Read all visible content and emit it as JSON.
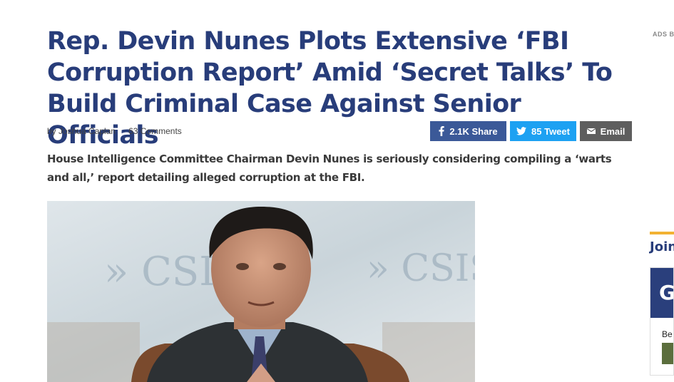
{
  "article": {
    "headline": "Rep. Devin Nunes Plots Extensive ‘FBI Corruption Report’ Amid ‘Secret Talks’ To Build Criminal Case Against Senior Officials",
    "author": "by Joshua Caplan",
    "comments": "63 Comments",
    "dek": "House Intelligence Committee Chairman Devin Nunes is seriously considering compiling a ‘warts and all,’ report detailing alleged corruption at the FBI.",
    "photo_backdrop_text": "» CSIS"
  },
  "share": {
    "facebook_label": "2.1K Share",
    "twitter_label": "85 Tweet",
    "email_label": "Email",
    "facebook_color": "#3b5998",
    "twitter_color": "#1da1f2",
    "email_color": "#5e5e5e",
    "facebook_icon": "facebook-icon",
    "twitter_icon": "twitter-icon",
    "email_icon": "envelope-icon"
  },
  "sidebar": {
    "ads_label": "ADS BY",
    "section_title": "Join",
    "card_heading": "G",
    "card_text": "Be"
  },
  "colors": {
    "headline": "#283d7a",
    "accent": "#f2b233"
  }
}
